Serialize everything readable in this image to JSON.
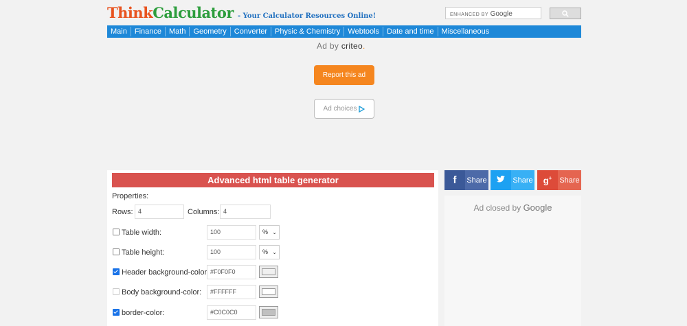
{
  "header": {
    "logo_think": "Think",
    "logo_calc": "Calculator",
    "tagline": "- Your Calculator Resources Online!",
    "search_enhanced": "ENHANCED BY",
    "search_google": "Google"
  },
  "nav": [
    "Main",
    "Finance",
    "Math",
    "Geometry",
    "Converter",
    "Physic & Chemistry",
    "Webtools",
    "Date and time",
    "Miscellaneous"
  ],
  "ad": {
    "adby": "Ad by",
    "criteo": "criteo",
    "report": "Report this ad",
    "adchoices": "Ad choices"
  },
  "panel": {
    "title": "Advanced html table generator",
    "properties": "Properties:",
    "rows_label": "Rows:",
    "rows_value": "4",
    "cols_label": "Columns:",
    "cols_value": "4",
    "table_width_label": "Table width:",
    "table_width_value": "100",
    "table_width_unit": "%",
    "table_height_label": "Table height:",
    "table_height_value": "100",
    "table_height_unit": "%",
    "header_bg_label": "Header background-color:",
    "header_bg_value": "#F0F0F0",
    "body_bg_label": "Body background-color:",
    "body_bg_value": "#FFFFFF",
    "border_label": "border-color:",
    "border_value": "#C0C0C0"
  },
  "share": {
    "facebook": "Share",
    "twitter": "Share",
    "googleplus": "Share"
  },
  "adclosed": {
    "text": "Ad closed by",
    "google": "Google"
  },
  "colors": {
    "nav_bg": "#1e88d8",
    "title_bar": "#d9534f",
    "report_btn": "#f5861f"
  }
}
